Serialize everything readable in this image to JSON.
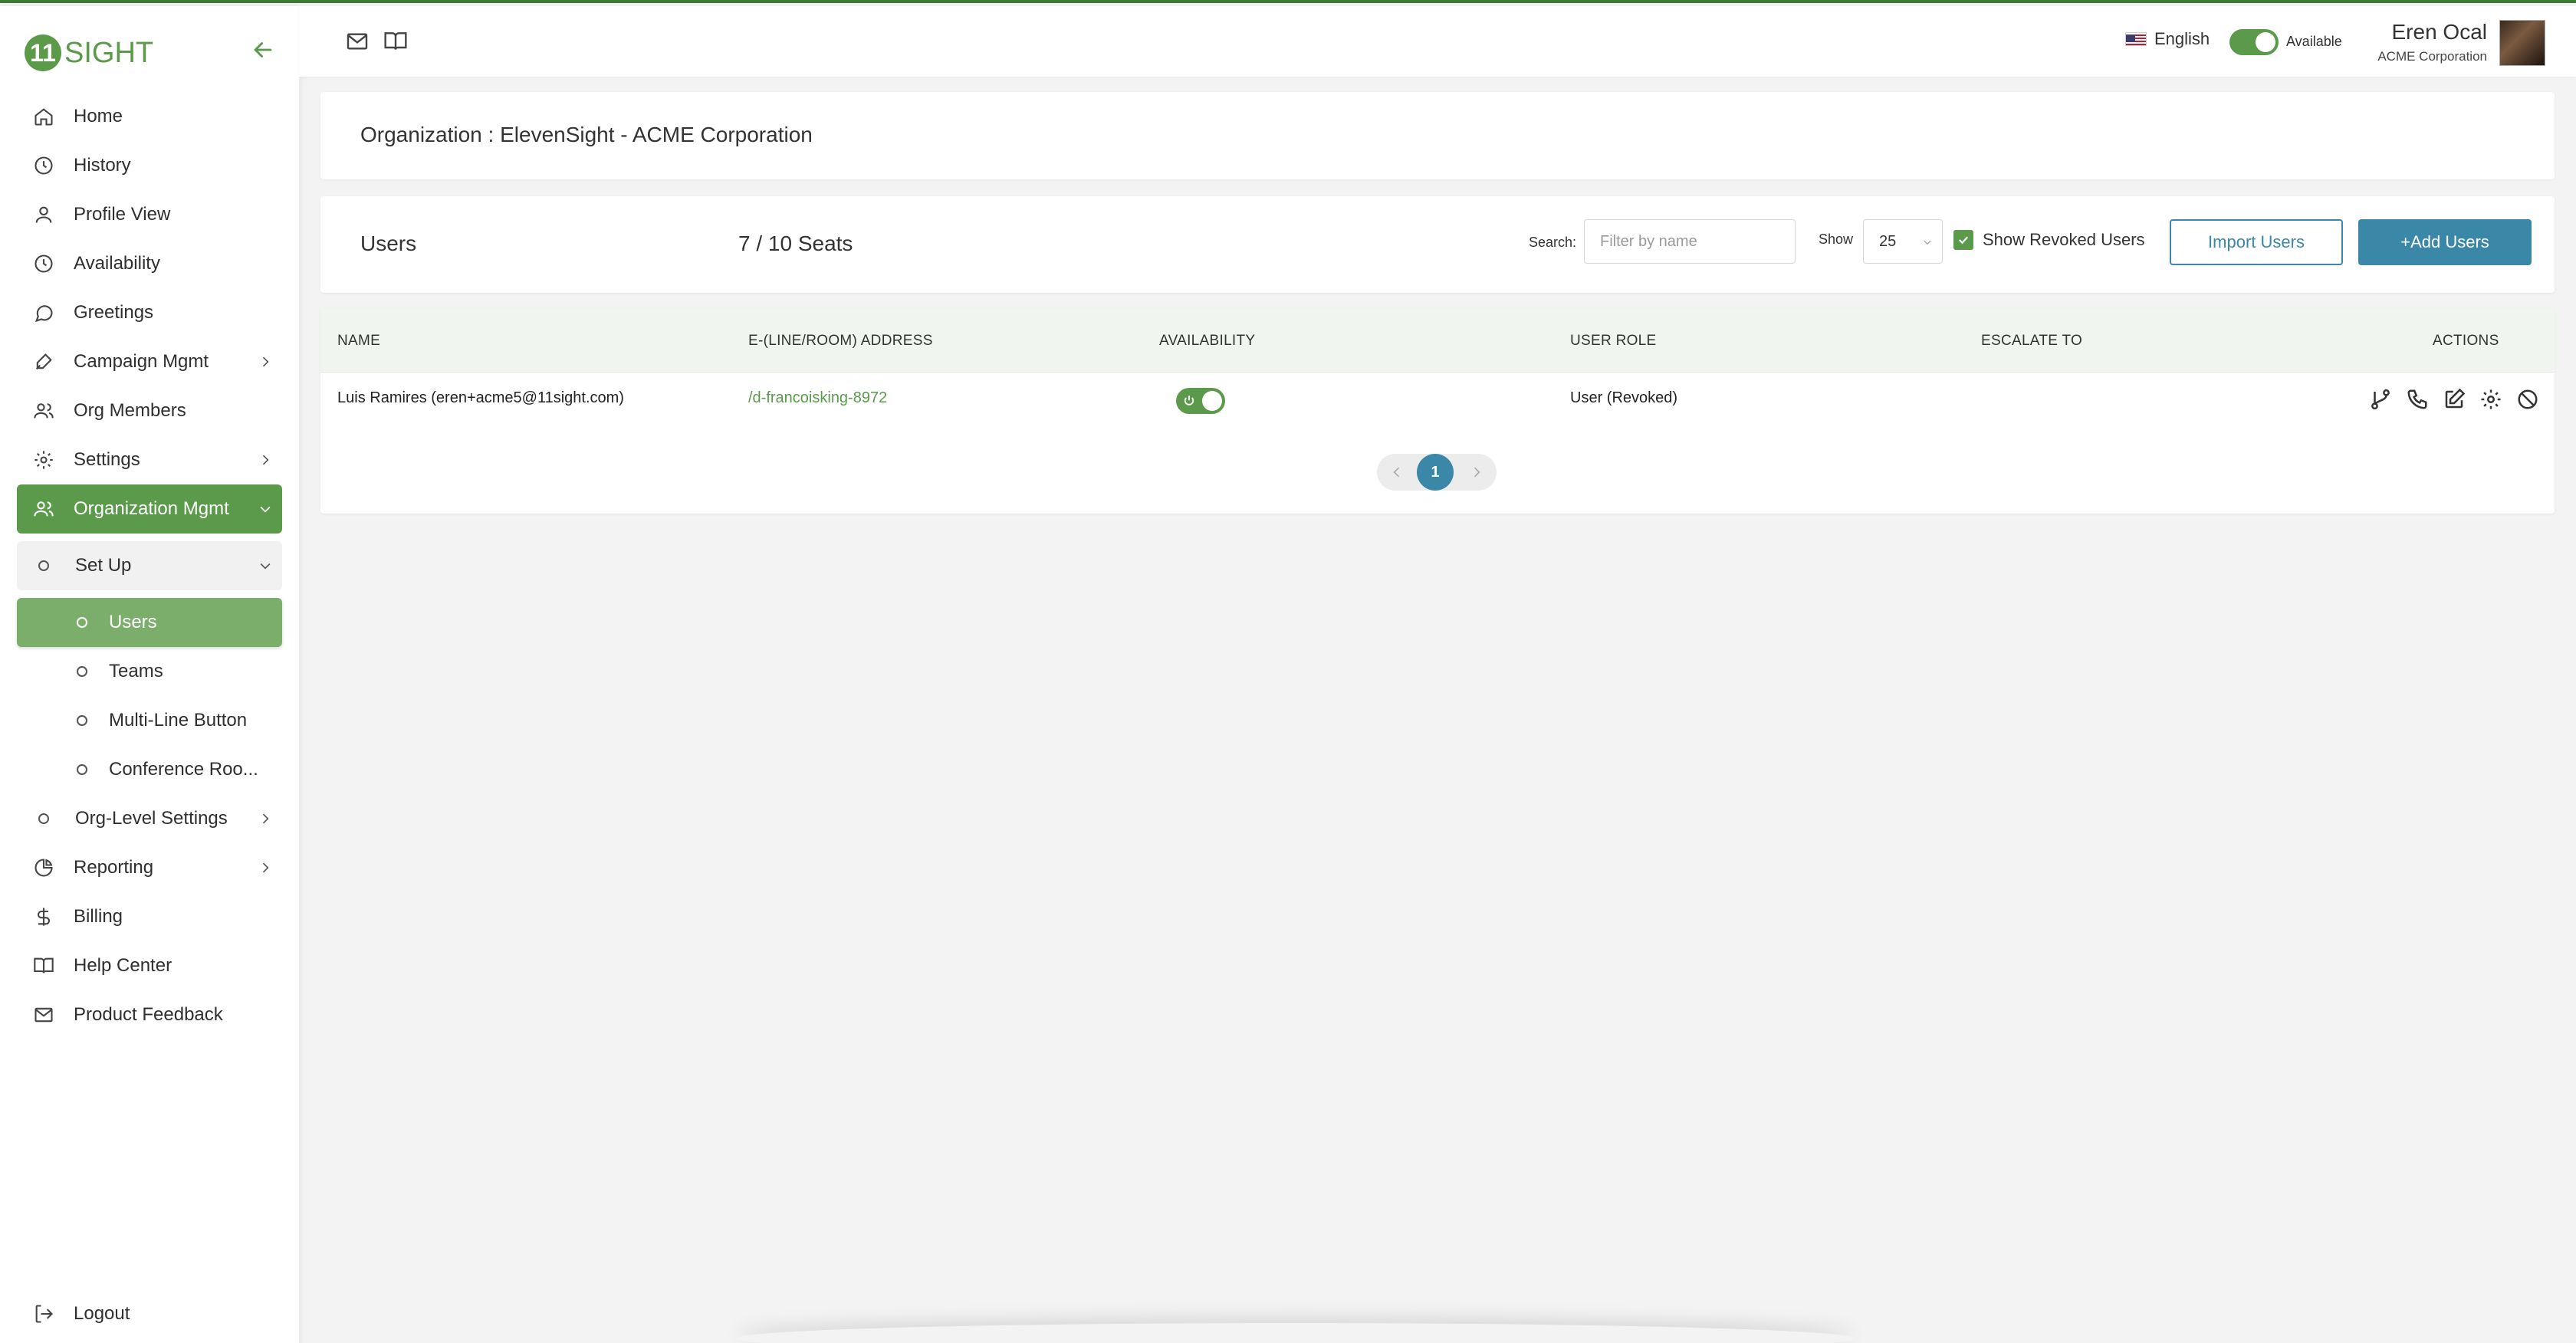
{
  "brand": {
    "logo_letter": "11",
    "logo_text": "SIGHT",
    "accent": "#5b9a4b",
    "primary_button": "#3a87a8"
  },
  "sidebar": {
    "items": [
      {
        "label": "Home",
        "icon": "home-icon"
      },
      {
        "label": "History",
        "icon": "clock-icon"
      },
      {
        "label": "Profile View",
        "icon": "user-icon"
      },
      {
        "label": "Availability",
        "icon": "clock-icon"
      },
      {
        "label": "Greetings",
        "icon": "chat-bubble-icon"
      },
      {
        "label": "Campaign Mgmt",
        "icon": "megaphone-icon"
      },
      {
        "label": "Org Members",
        "icon": "users-icon"
      },
      {
        "label": "Settings",
        "icon": "gear-icon"
      },
      {
        "label": "Organization Mgmt",
        "icon": "users-icon"
      }
    ],
    "setup": {
      "label": "Set Up"
    },
    "sub_items": [
      {
        "label": "Users"
      },
      {
        "label": "Teams"
      },
      {
        "label": "Multi-Line Button"
      },
      {
        "label": "Conference Roo..."
      }
    ],
    "more_items": [
      {
        "label": "Org-Level Settings"
      },
      {
        "label": "Reporting",
        "icon": "pie-chart-icon"
      },
      {
        "label": "Billing",
        "icon": "dollar-icon"
      },
      {
        "label": "Help Center",
        "icon": "book-icon"
      },
      {
        "label": "Product Feedback",
        "icon": "mail-icon"
      }
    ],
    "logout": "Logout"
  },
  "topbar": {
    "language": "English",
    "availability_label": "Available",
    "user_name": "Eren Ocal",
    "user_org": "ACME Corporation"
  },
  "org": {
    "title": "Organization : ElevenSight - ACME Corporation"
  },
  "users_panel": {
    "title": "Users",
    "seats": "7 / 10 Seats",
    "search_label": "Search:",
    "search_placeholder": "Filter by name",
    "show_label": "Show",
    "show_value": "25",
    "show_revoked_label": "Show Revoked Users",
    "import_label": "Import Users",
    "add_label": "+Add Users"
  },
  "table": {
    "headers": [
      "NAME",
      "E-(LINE/ROOM) ADDRESS",
      "AVAILABILITY",
      "USER ROLE",
      "ESCALATE TO",
      "ACTIONS"
    ],
    "rows": [
      {
        "name": "Luis Ramires (eren+acme5@11sight.com)",
        "address": "/d-francoisking-8972",
        "available": true,
        "role": "User (Revoked)",
        "escalate_to": ""
      }
    ]
  },
  "pagination": {
    "current_page": "1"
  }
}
